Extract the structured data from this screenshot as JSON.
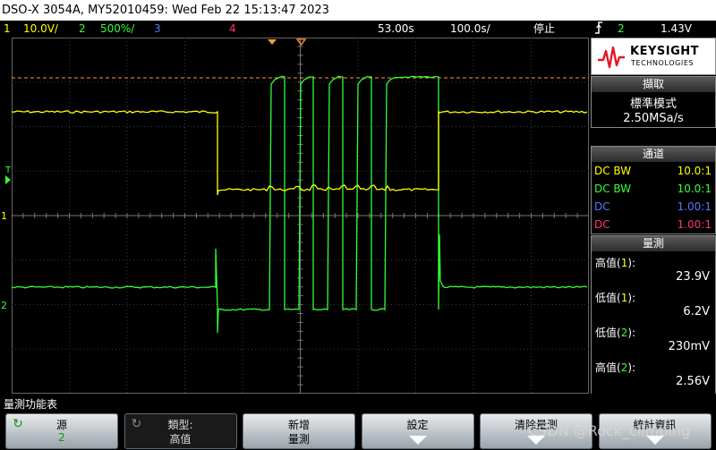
{
  "titlebar": {
    "text": "DSO-X 3054A, MY52010459: Wed Feb 22 15:13:47 2023"
  },
  "status": {
    "ch1_num": "1",
    "ch1_scale": "10.0V/",
    "ch2_num": "2",
    "ch2_scale": "500%/",
    "ch3_num": "3",
    "ch4_num": "4",
    "delay": "53.00s",
    "timebase": "100.0s/",
    "run_state": "停止",
    "trig_icon": "trigger-edge-icon",
    "trig_src": "2",
    "trig_level": "1.43V"
  },
  "screen": {
    "ch1_marker": "1",
    "ch2_marker": "2",
    "trig_marker": "T"
  },
  "brand": {
    "name": "KEYSIGHT",
    "sub": "TECHNOLOGIES"
  },
  "acq": {
    "header": "擷取",
    "mode": "標準模式",
    "rate": "2.50MSa/s"
  },
  "channels": {
    "header": "通道",
    "rows": [
      {
        "coupling": "DC BW",
        "probe": "10.0:1",
        "color": "#ffff00"
      },
      {
        "coupling": "DC BW",
        "probe": "10.0:1",
        "color": "#33ff33"
      },
      {
        "coupling": "DC",
        "probe": "1.00:1",
        "color": "#5577ff"
      },
      {
        "coupling": "DC",
        "probe": "1.00:1",
        "color": "#ff3377"
      }
    ]
  },
  "meas": {
    "header": "量測",
    "items": [
      {
        "label": "高值(",
        "ch": "1",
        "tail": "):",
        "value": "23.9V"
      },
      {
        "label": "低值(",
        "ch": "1",
        "tail": "):",
        "value": "6.2V"
      },
      {
        "label": "低值(",
        "ch": "2",
        "tail": "):",
        "value": "230mV"
      },
      {
        "label": "高值(",
        "ch": "2",
        "tail": "):",
        "value": "2.56V"
      }
    ]
  },
  "softkeys": {
    "menu_title": "量測功能表",
    "keys": [
      {
        "l1": "源",
        "l2": "2"
      },
      {
        "l1": "類型:",
        "l2": "高值"
      },
      {
        "l1": "新增",
        "l2": "量測"
      },
      {
        "l1": "設定",
        "l2": ""
      },
      {
        "l1": "清除量測",
        "l2": ""
      },
      {
        "l1": "統計資訊",
        "l2": ""
      }
    ]
  },
  "watermark": "CSDN @Rock_climbing",
  "colors": {
    "ch1": "#ffff00",
    "ch2": "#33ff33",
    "ch3": "#5577ff",
    "ch4": "#ff3377"
  }
}
